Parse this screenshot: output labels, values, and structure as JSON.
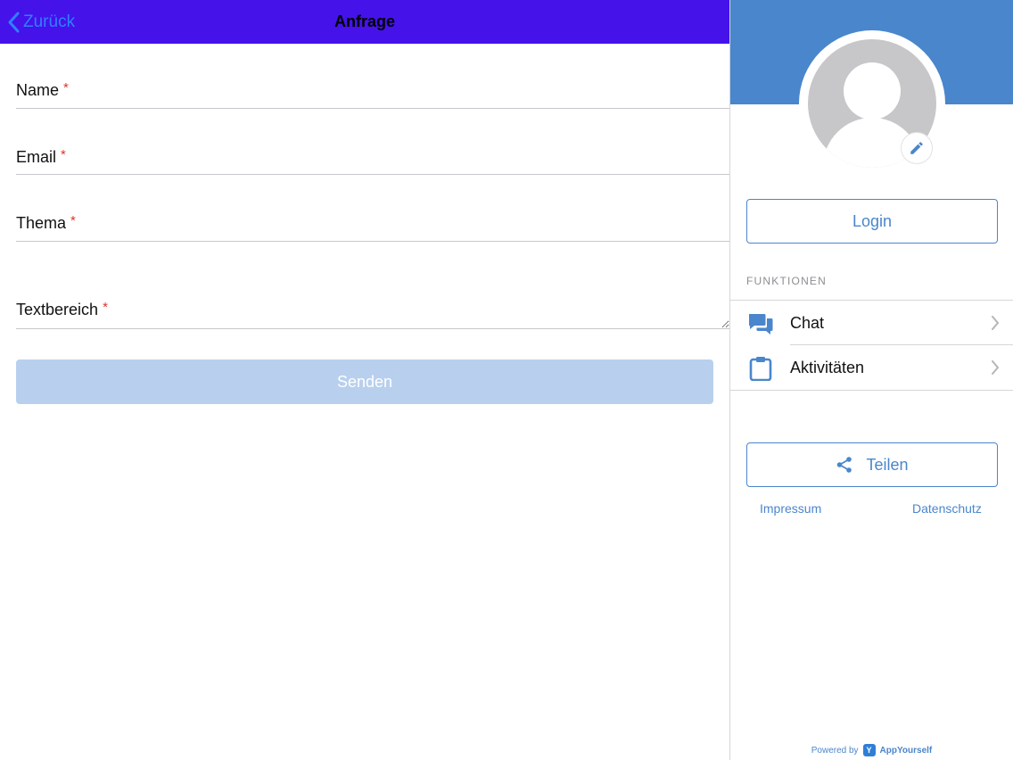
{
  "navbar": {
    "back_label": "Zurück",
    "title": "Anfrage"
  },
  "form": {
    "fields": [
      {
        "label": "Name",
        "required_mark": "*"
      },
      {
        "label": "Email",
        "required_mark": "*"
      },
      {
        "label": "Thema",
        "required_mark": "*"
      },
      {
        "label": "Textbereich",
        "required_mark": "*"
      }
    ],
    "submit_label": "Senden"
  },
  "sidebar": {
    "login_label": "Login",
    "section_title": "FUNKTIONEN",
    "items": [
      {
        "label": "Chat",
        "icon": "chat-icon"
      },
      {
        "label": "Aktivitäten",
        "icon": "clipboard-icon"
      }
    ],
    "share_label": "Teilen",
    "links": {
      "impressum": "Impressum",
      "datenschutz": "Datenschutz"
    },
    "powered_by": {
      "prefix": "Powered by",
      "logo_letter": "Y",
      "brand": "AppYourself"
    }
  },
  "colors": {
    "navbar": "#4512ea",
    "accent": "#4a86cc",
    "back_link": "#2f80ff",
    "submit_disabled": "#b8d0ee",
    "required": "#e0342a"
  }
}
